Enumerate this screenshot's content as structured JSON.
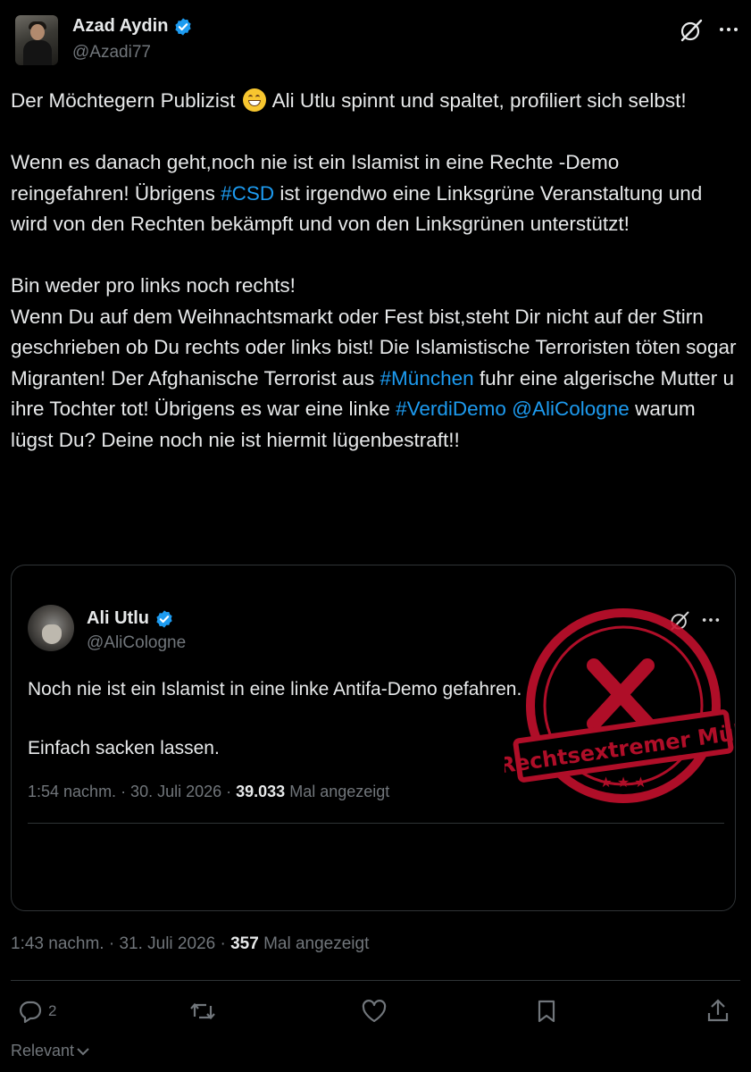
{
  "author": {
    "name": "Azad Aydin",
    "handle": "@Azadi77"
  },
  "header_icons": [
    "grok-icon",
    "more-options-icon"
  ],
  "tweet": {
    "part1": "Der Möchtegern Publizist ",
    "emoji": "grinning-face-with-smiling-eyes",
    "part2": " Ali Utlu spinnt und spaltet, profiliert sich selbst!\n\nWenn es danach geht,noch nie ist ein Islamist in eine Rechte -Demo reingefahren! Übrigens ",
    "tag_csd": "#CSD",
    "part3": " ist irgendwo eine Linksgrüne Veranstaltung und wird von den Rechten bekämpft und von den Linksgrünen unterstützt!\n\nBin weder pro links noch rechts!\nWenn Du auf dem Weihnachtsmarkt oder Fest bist,steht Dir nicht auf der Stirn geschrieben ob Du rechts oder links bist! Die Islamistische Terroristen töten sogar Migranten! Der Afghanische Terrorist aus ",
    "tag_muenchen": "#München",
    "part4": " fuhr eine algerische Mutter u ihre Tochter tot! Übrigens es war eine linke ",
    "tag_verdi": "#VerdiDemo",
    "mention": "@AliCologne",
    "part5": " warum lügst Du? Deine noch nie ist hiermit lügenbestraft!!"
  },
  "quote": {
    "name": "Ali Utlu",
    "handle": "@AliCologne",
    "text": "Noch nie ist ein Islamist in eine linke Antifa-Demo gefahren.\n\nEinfach sacken lassen.",
    "time": "1:54 nachm. · 30. Juli 2026 · ",
    "views": "39.033",
    "views_label": " Mal angezeigt",
    "stamp_text": "Rechtsextremer Müll",
    "stamp_color": "#c8102e"
  },
  "meta": {
    "time": "1:43 nachm. · 31. Juli 2026 · ",
    "views": "357",
    "views_label": " Mal angezeigt"
  },
  "actions": {
    "reply_count": "2",
    "icons": [
      "reply-icon",
      "repost-icon",
      "like-icon",
      "bookmark-icon",
      "share-icon"
    ]
  },
  "sort_label": "Relevant",
  "colors": {
    "background": "#000000",
    "text": "#e7e9ea",
    "secondary": "#71767b",
    "link": "#1d9bf0",
    "verified": "#1d9bf0",
    "border": "#2f3336"
  }
}
